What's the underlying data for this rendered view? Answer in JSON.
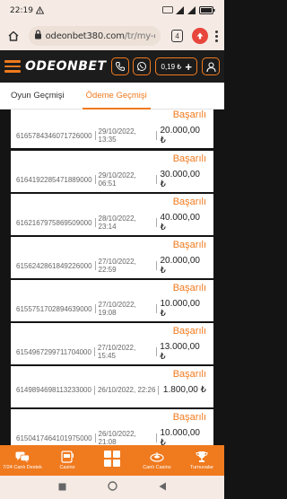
{
  "status_bar": {
    "time": "22:19",
    "battery": "98"
  },
  "browser": {
    "url_host": "odeonbet380.com",
    "url_path": "/tr/my-cas",
    "tab_count": "4"
  },
  "header": {
    "logo": "ODEONBET",
    "balance": "0,19 ₺"
  },
  "tabs": [
    {
      "label": "Oyun Geçmişi",
      "active": false
    },
    {
      "label": "Ödeme Geçmişi",
      "active": true
    }
  ],
  "payments": [
    {
      "status": "Başarılı",
      "id": "6165784346071726000",
      "date": "29/10/2022, 13:35",
      "amount": "20.000,00 ₺"
    },
    {
      "status": "Başarılı",
      "id": "6164192285471889000",
      "date": "29/10/2022, 06:51",
      "amount": "30.000,00 ₺"
    },
    {
      "status": "Başarılı",
      "id": "6162167975869509000",
      "date": "28/10/2022, 23:14",
      "amount": "40.000,00 ₺"
    },
    {
      "status": "Başarılı",
      "id": "6156242861849226000",
      "date": "27/10/2022, 22:59",
      "amount": "20.000,00 ₺"
    },
    {
      "status": "Başarılı",
      "id": "6155751702894639000",
      "date": "27/10/2022, 19:08",
      "amount": "10.000,00 ₺"
    },
    {
      "status": "Başarılı",
      "id": "6154967299711704000",
      "date": "27/10/2022, 15:45",
      "amount": "13.000,00 ₺"
    },
    {
      "status": "Başarılı",
      "id": "6149894698113233000",
      "date": "26/10/2022, 22:26",
      "amount": "1.800,00 ₺"
    },
    {
      "status": "Başarılı",
      "id": "6150417464101975000",
      "date": "26/10/2022, 21:08",
      "amount": "10.000,00 ₺"
    }
  ],
  "bottom_nav": [
    {
      "label": "7/24 Canlı Destek",
      "icon": "chat-icon"
    },
    {
      "label": "Casino",
      "icon": "slot-machine-icon"
    },
    {
      "label": "",
      "icon": "grid-menu-icon"
    },
    {
      "label": "Canlı Casino",
      "icon": "roulette-icon"
    },
    {
      "label": "Turnuvalar",
      "icon": "trophy-icon"
    }
  ],
  "colors": {
    "accent": "#f07a1e",
    "header_bg": "#1c1c1c",
    "list_bg": "#141414",
    "status_text": "#f07a1e"
  }
}
